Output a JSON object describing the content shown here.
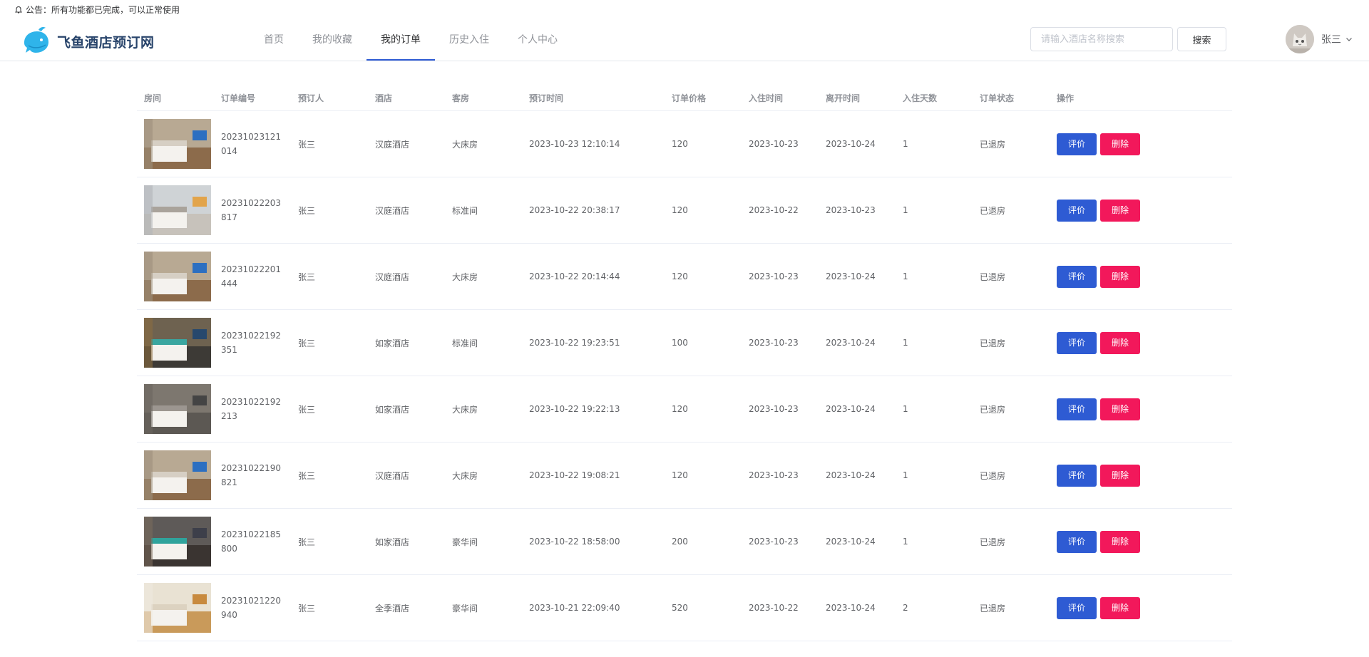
{
  "notice": {
    "text": "公告：所有功能都已完成，可以正常使用"
  },
  "logo": {
    "text": "飞鱼酒店预订网"
  },
  "nav": [
    {
      "label": "首页",
      "active": false
    },
    {
      "label": "我的收藏",
      "active": false
    },
    {
      "label": "我的订单",
      "active": true
    },
    {
      "label": "历史入住",
      "active": false
    },
    {
      "label": "个人中心",
      "active": false
    }
  ],
  "search": {
    "placeholder": "请输入酒店名称搜索",
    "button": "搜索"
  },
  "user": {
    "name": "张三"
  },
  "colors": {
    "primary": "#2e5bd3",
    "danger": "#f2185b",
    "logo": "#28446b"
  },
  "table": {
    "headers": [
      "房间",
      "订单编号",
      "预订人",
      "酒店",
      "客房",
      "预订时间",
      "订单价格",
      "入住时间",
      "离开时间",
      "入住天数",
      "订单状态",
      "操作"
    ],
    "rows": [
      {
        "order_no": "20231023121014",
        "booker": "张三",
        "hotel": "汉庭酒店",
        "room": "大床房",
        "booked_at": "2023-10-23 12:10:14",
        "price": "120",
        "checkin": "2023-10-23",
        "checkout": "2023-10-24",
        "days": "1",
        "status": "已退房",
        "eval": "评价",
        "del": "删除"
      },
      {
        "order_no": "20231022203817",
        "booker": "张三",
        "hotel": "汉庭酒店",
        "room": "标准间",
        "booked_at": "2023-10-22 20:38:17",
        "price": "120",
        "checkin": "2023-10-22",
        "checkout": "2023-10-23",
        "days": "1",
        "status": "已退房",
        "eval": "评价",
        "del": "删除"
      },
      {
        "order_no": "20231022201444",
        "booker": "张三",
        "hotel": "汉庭酒店",
        "room": "大床房",
        "booked_at": "2023-10-22 20:14:44",
        "price": "120",
        "checkin": "2023-10-23",
        "checkout": "2023-10-24",
        "days": "1",
        "status": "已退房",
        "eval": "评价",
        "del": "删除"
      },
      {
        "order_no": "20231022192351",
        "booker": "张三",
        "hotel": "如家酒店",
        "room": "标准间",
        "booked_at": "2023-10-22 19:23:51",
        "price": "100",
        "checkin": "2023-10-23",
        "checkout": "2023-10-24",
        "days": "1",
        "status": "已退房",
        "eval": "评价",
        "del": "删除"
      },
      {
        "order_no": "20231022192213",
        "booker": "张三",
        "hotel": "如家酒店",
        "room": "大床房",
        "booked_at": "2023-10-22 19:22:13",
        "price": "120",
        "checkin": "2023-10-23",
        "checkout": "2023-10-24",
        "days": "1",
        "status": "已退房",
        "eval": "评价",
        "del": "删除"
      },
      {
        "order_no": "20231022190821",
        "booker": "张三",
        "hotel": "汉庭酒店",
        "room": "大床房",
        "booked_at": "2023-10-22 19:08:21",
        "price": "120",
        "checkin": "2023-10-23",
        "checkout": "2023-10-24",
        "days": "1",
        "status": "已退房",
        "eval": "评价",
        "del": "删除"
      },
      {
        "order_no": "20231022185800",
        "booker": "张三",
        "hotel": "如家酒店",
        "room": "豪华间",
        "booked_at": "2023-10-22 18:58:00",
        "price": "200",
        "checkin": "2023-10-23",
        "checkout": "2023-10-24",
        "days": "1",
        "status": "已退房",
        "eval": "评价",
        "del": "删除"
      },
      {
        "order_no": "20231021220940",
        "booker": "张三",
        "hotel": "全季酒店",
        "room": "豪华间",
        "booked_at": "2023-10-21 22:09:40",
        "price": "520",
        "checkin": "2023-10-22",
        "checkout": "2023-10-24",
        "days": "2",
        "status": "已退房",
        "eval": "评价",
        "del": "删除"
      }
    ]
  }
}
